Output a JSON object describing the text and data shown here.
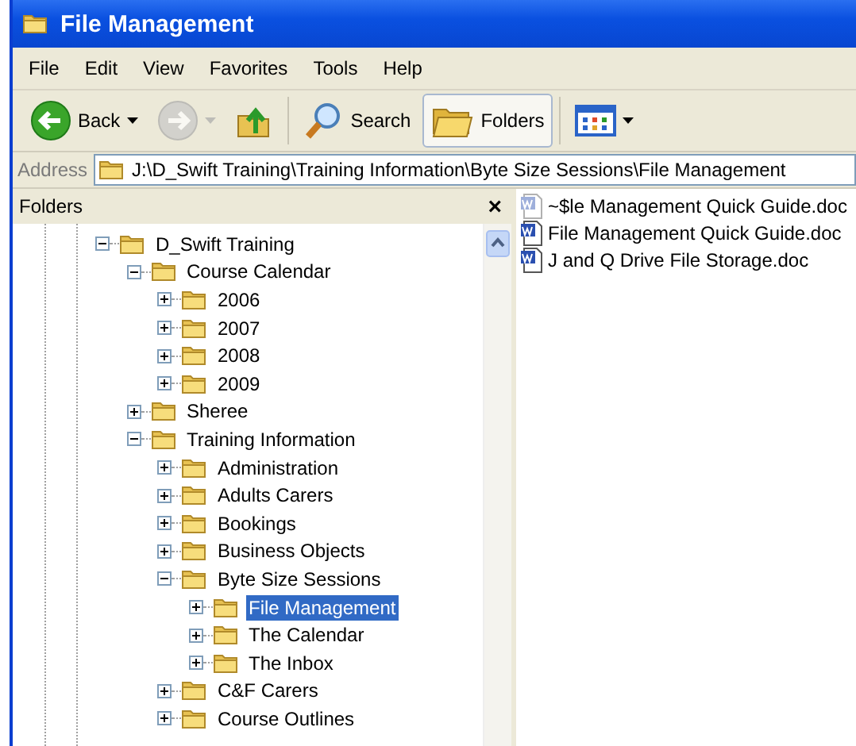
{
  "window": {
    "title": "File Management"
  },
  "menu": [
    "File",
    "Edit",
    "View",
    "Favorites",
    "Tools",
    "Help"
  ],
  "toolbar": [
    {
      "kind": "back",
      "label": "Back",
      "disabled": false,
      "pressed": false
    },
    {
      "kind": "forward",
      "disabled": true,
      "pressed": false
    },
    {
      "kind": "up",
      "disabled": false,
      "pressed": false
    },
    {
      "kind": "search",
      "label": "Search",
      "disabled": false,
      "pressed": false
    },
    {
      "kind": "folders",
      "label": "Folders",
      "disabled": false,
      "pressed": true
    },
    {
      "kind": "views",
      "disabled": false,
      "pressed": false
    }
  ],
  "address": {
    "label": "Address",
    "value": "J:\\D_Swift Training\\Training Information\\Byte Size Sessions\\File Management"
  },
  "folders_pane": {
    "title": "Folders",
    "close": "×",
    "tree": [
      {
        "label": "D_Swift Training",
        "expanded": true,
        "selected": false,
        "children": [
          {
            "label": "Course Calendar",
            "expanded": true,
            "selected": false,
            "children": [
              {
                "label": "2006",
                "expanded": false,
                "selected": false
              },
              {
                "label": "2007",
                "expanded": false,
                "selected": false
              },
              {
                "label": "2008",
                "expanded": false,
                "selected": false
              },
              {
                "label": "2009",
                "expanded": false,
                "selected": false
              }
            ]
          },
          {
            "label": "Sheree",
            "expanded": false,
            "selected": false
          },
          {
            "label": "Training Information",
            "expanded": true,
            "selected": false,
            "children": [
              {
                "label": "Administration",
                "expanded": false,
                "selected": false
              },
              {
                "label": "Adults Carers",
                "expanded": false,
                "selected": false
              },
              {
                "label": "Bookings",
                "expanded": false,
                "selected": false
              },
              {
                "label": "Business Objects",
                "expanded": false,
                "selected": false
              },
              {
                "label": "Byte Size Sessions",
                "expanded": true,
                "selected": false,
                "children": [
                  {
                    "label": "File Management",
                    "expanded": false,
                    "selected": true
                  },
                  {
                    "label": "The Calendar",
                    "expanded": false,
                    "selected": false
                  },
                  {
                    "label": "The Inbox",
                    "expanded": false,
                    "selected": false
                  }
                ]
              },
              {
                "label": "C&F Carers",
                "expanded": false,
                "selected": false
              },
              {
                "label": "Course Outlines",
                "expanded": false,
                "selected": false
              }
            ]
          }
        ]
      }
    ]
  },
  "files": [
    {
      "name": "~$le Management Quick Guide.doc",
      "hidden": true
    },
    {
      "name": "File Management Quick Guide.doc",
      "hidden": false
    },
    {
      "name": "J and Q Drive File Storage.doc",
      "hidden": false
    }
  ]
}
